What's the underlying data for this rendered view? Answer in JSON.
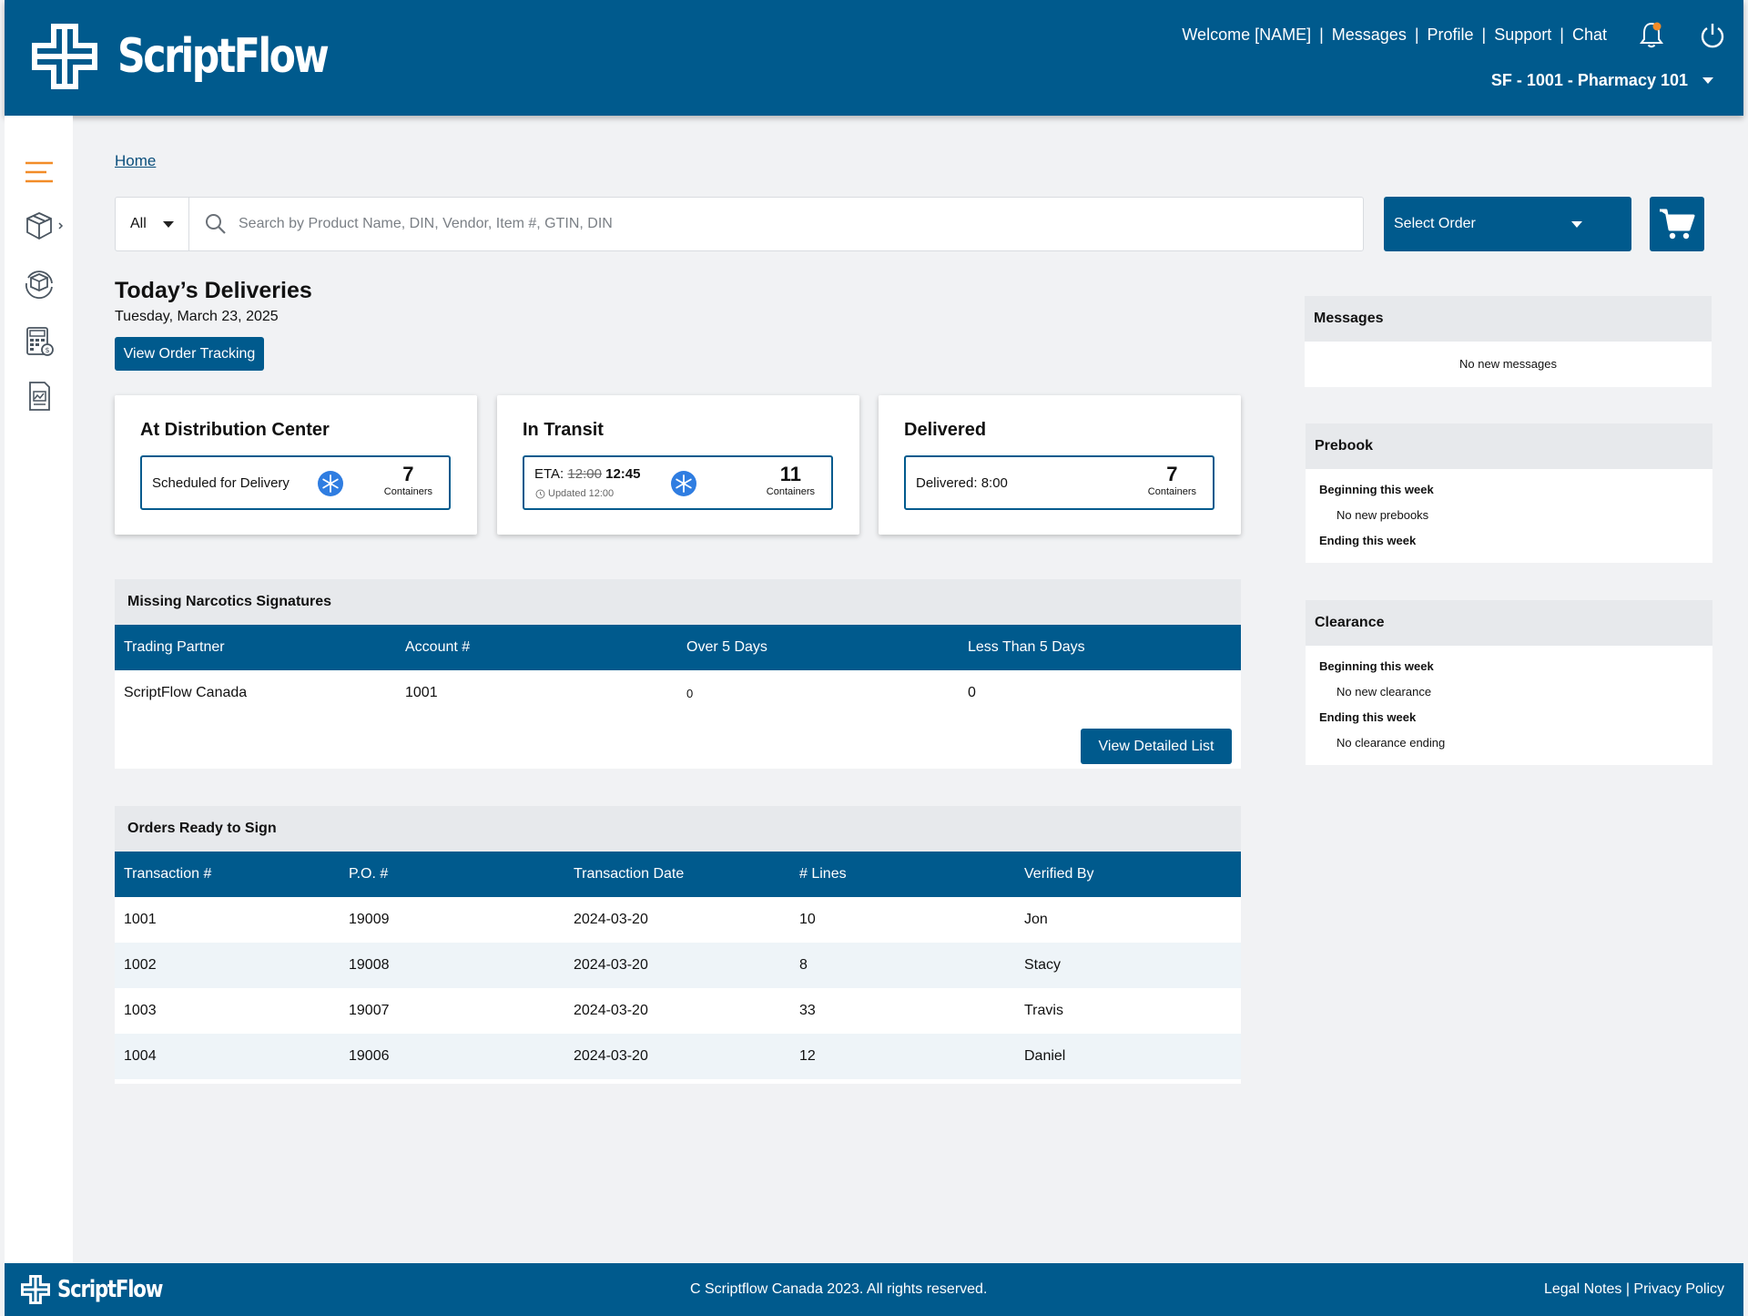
{
  "header": {
    "brand": "ScriptFlow",
    "nav": {
      "welcome": "Welcome [NAME]",
      "messages": "Messages",
      "profile": "Profile",
      "support": "Support",
      "chat": "Chat"
    },
    "store": "SF - 1001 - Pharmacy 101",
    "icons": [
      "bell-icon",
      "power-icon"
    ],
    "notification_dot_color": "#f28c28"
  },
  "sidebar": {
    "items": [
      "menu-icon",
      "package-icon",
      "returns-icon",
      "calculator-icon",
      "report-icon"
    ],
    "accent": "#f28c28"
  },
  "breadcrumb": "Home",
  "search": {
    "filter": "All",
    "placeholder": "Search by Product Name, DIN, Vendor, Item #, GTIN, DIN"
  },
  "select_order": "Select Order",
  "deliveries": {
    "title": "Today’s Deliveries",
    "date": "Tuesday, March 23, 2025",
    "track_button": "View Order Tracking",
    "cards": [
      {
        "title": "At Distribution Center",
        "label": "Scheduled for Delivery",
        "count": "7",
        "unit": "Containers"
      },
      {
        "title": "In Transit",
        "eta_prefix": "ETA:",
        "eta_old": "12:00",
        "eta_new": "12:45",
        "updated": "Updated 12:00",
        "count": "11",
        "unit": "Containers"
      },
      {
        "title": "Delivered",
        "label": "Delivered: 8:00",
        "count": "7",
        "unit": "Containers"
      }
    ]
  },
  "narcotics": {
    "title": "Missing Narcotics Signatures",
    "columns": [
      "Trading Partner",
      "Account #",
      "Over 5 Days",
      "Less Than 5 Days"
    ],
    "rows": [
      [
        "ScriptFlow Canada",
        "1001",
        "0",
        "0"
      ]
    ],
    "button": "View Detailed List"
  },
  "orders": {
    "title": "Orders Ready to Sign",
    "columns": [
      "Transaction #",
      "P.O. #",
      "Transaction Date",
      "# Lines",
      "Verified By"
    ],
    "rows": [
      [
        "1001",
        "19009",
        "2024-03-20",
        "10",
        "Jon"
      ],
      [
        "1002",
        "19008",
        "2024-03-20",
        "8",
        "Stacy"
      ],
      [
        "1003",
        "19007",
        "2024-03-20",
        "33",
        "Travis"
      ],
      [
        "1004",
        "19006",
        "2024-03-20",
        "12",
        "Daniel"
      ]
    ]
  },
  "right": {
    "messages": {
      "title": "Messages",
      "empty": "No new messages"
    },
    "prebook": {
      "title": "Prebook",
      "beginning": "Beginning this week",
      "beginning_empty": "No new prebooks",
      "ending": "Ending this week"
    },
    "clearance": {
      "title": "Clearance",
      "beginning": "Beginning this week",
      "beginning_empty": "No new clearance",
      "ending": "Ending this week",
      "ending_empty": "No clearance ending"
    }
  },
  "footer": {
    "brand": "ScriptFlow",
    "copyright": "C Scriptflow Canada 2023. All rights reserved.",
    "legal": "Legal Notes",
    "privacy": "Privacy Policy"
  },
  "colors": {
    "primary": "#005a8d",
    "background": "#f1f2f4",
    "snowflake": "#2f7de1"
  }
}
